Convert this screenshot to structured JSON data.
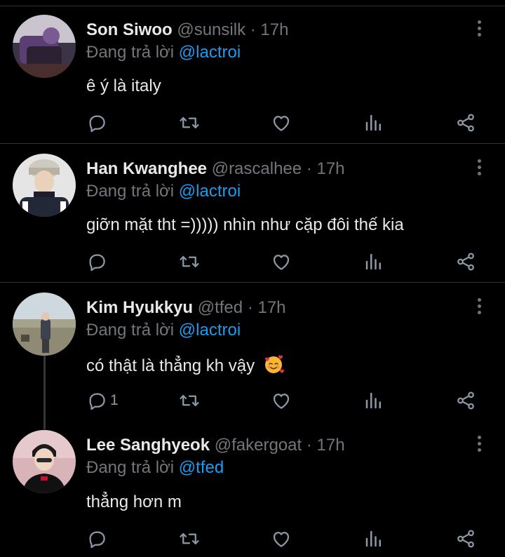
{
  "colors": {
    "background": "#000000",
    "text": "#e7e9ea",
    "muted": "#71767b",
    "mention": "#1d9bf0",
    "divider": "#2f3336"
  },
  "tweets": [
    {
      "display_name": "Son Siwoo",
      "handle": "@sunsilk",
      "separator": "·",
      "time": "17h",
      "reply_prefix": "Đang trả lời",
      "reply_to": "@lactroi",
      "text": "ê ý là italy",
      "reply_count": "",
      "icons": [
        "reply-icon",
        "retweet-icon",
        "like-icon",
        "views-icon",
        "share-icon",
        "more-icon"
      ]
    },
    {
      "display_name": "Han Kwanghee",
      "handle": "@rascalhee",
      "separator": "·",
      "time": "17h",
      "reply_prefix": "Đang trả lời",
      "reply_to": "@lactroi",
      "text": "giỡn mặt tht =))))) nhìn như cặp đôi thế kia",
      "reply_count": "",
      "icons": [
        "reply-icon",
        "retweet-icon",
        "like-icon",
        "views-icon",
        "share-icon",
        "more-icon"
      ]
    },
    {
      "display_name": "Kim Hyukkyu",
      "handle": "@tfed",
      "separator": "·",
      "time": "17h",
      "reply_prefix": "Đang trả lời",
      "reply_to": "@lactroi",
      "text": "có thật là thẳng kh vậy",
      "emoji": "smiling-face-with-hearts",
      "reply_count": "1",
      "icons": [
        "reply-icon",
        "retweet-icon",
        "like-icon",
        "views-icon",
        "share-icon",
        "more-icon"
      ]
    },
    {
      "display_name": "Lee Sanghyeok",
      "handle": "@fakergoat",
      "separator": "·",
      "time": "17h",
      "reply_prefix": "Đang trả lời",
      "reply_to": "@tfed",
      "text": "thẳng hơn m",
      "reply_count": "",
      "icons": [
        "reply-icon",
        "retweet-icon",
        "like-icon",
        "views-icon",
        "share-icon",
        "more-icon"
      ]
    }
  ]
}
